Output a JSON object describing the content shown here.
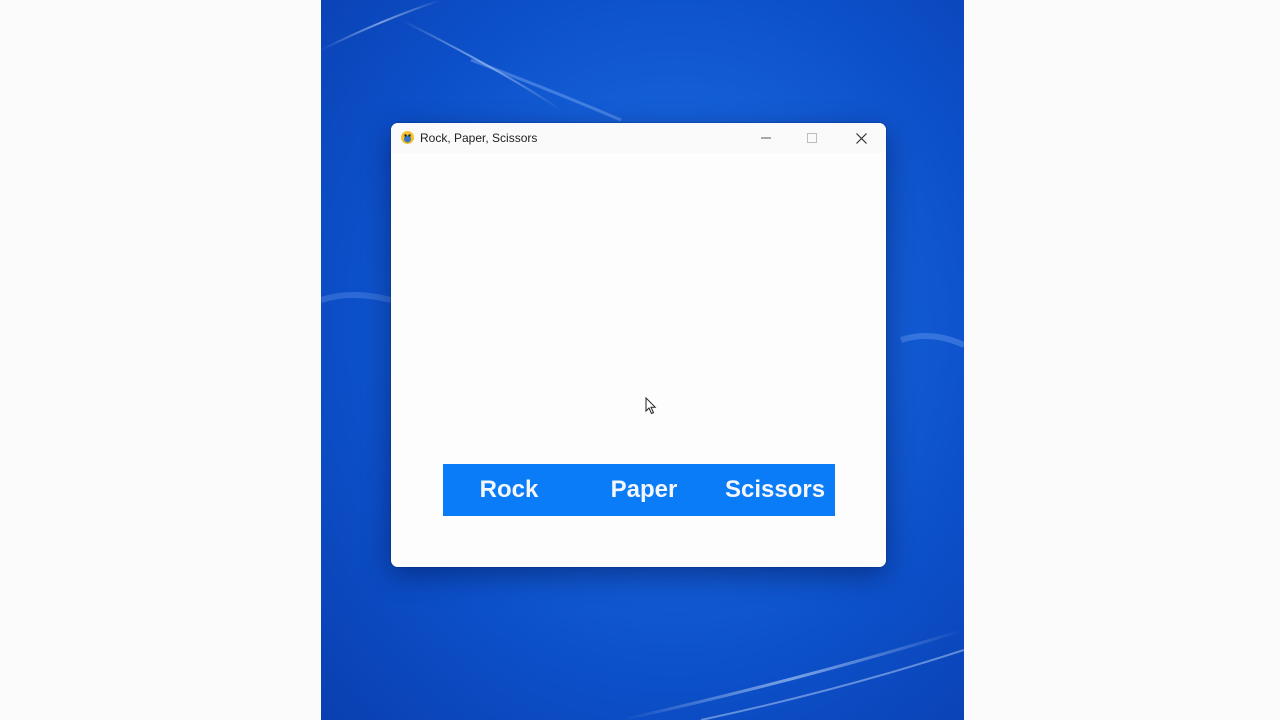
{
  "window": {
    "title": "Rock, Paper, Scissors",
    "icon": "pygame-snake-icon",
    "controls": {
      "minimize_icon": "minimize-icon",
      "maximize_icon": "maximize-icon",
      "close_icon": "close-icon"
    }
  },
  "game": {
    "bar_color": "#0a7cf7",
    "text_color": "#f4f6fa",
    "choices": [
      {
        "label": "Rock"
      },
      {
        "label": "Paper"
      },
      {
        "label": "Scissors"
      }
    ]
  },
  "desktop": {
    "background_color": "#1560d8"
  }
}
